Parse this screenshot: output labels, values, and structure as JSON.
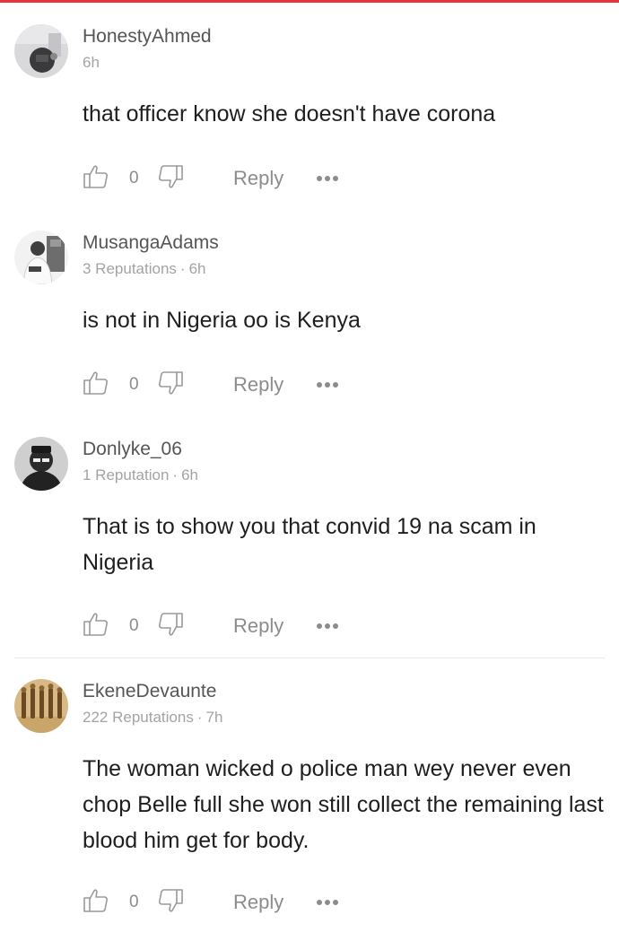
{
  "theme": {
    "accent": "#e8323c",
    "username_color": "#555555",
    "meta_color": "#a3a3a3",
    "action_color": "#8c8c8c"
  },
  "comments": [
    {
      "username": "HonestyAhmed",
      "reputation": "",
      "time": "6h",
      "text": "that officer know she doesn't have corona",
      "likes": "0",
      "reply_label": "Reply",
      "more_icon": "more-dots-icon"
    },
    {
      "username": "MusangaAdams",
      "reputation": "3 Reputations",
      "time": "6h",
      "text": "is not in Nigeria oo is Kenya",
      "likes": "0",
      "reply_label": "Reply",
      "more_icon": "more-dots-icon"
    },
    {
      "username": "Donlyke_06",
      "reputation": "1 Reputation",
      "time": "6h",
      "text": "That is to show you that convid 19 na scam in Nigeria",
      "likes": "0",
      "reply_label": "Reply",
      "more_icon": "more-dots-icon"
    },
    {
      "username": "EkeneDevaunte",
      "reputation": "222 Reputations",
      "time": "7h",
      "text": "The woman wicked o police man wey never even chop Belle full she won still collect the remaining last blood him get for body.",
      "likes": "0",
      "reply_label": "Reply",
      "more_icon": "more-dots-icon"
    }
  ],
  "meta_separator": "·"
}
